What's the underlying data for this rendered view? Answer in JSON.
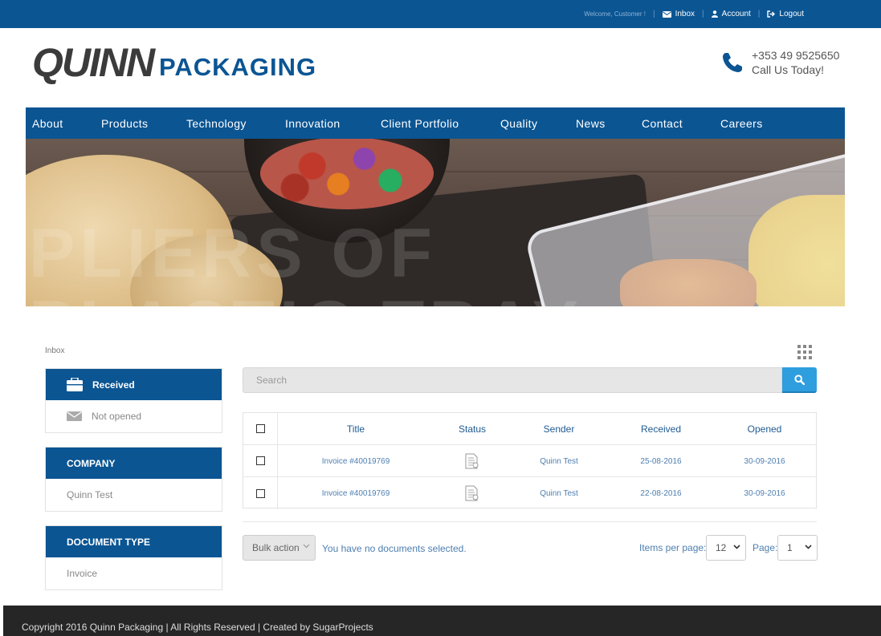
{
  "topbar": {
    "welcome": "Welcome, Customer !",
    "inbox": "Inbox",
    "account": "Account",
    "logout": "Logout"
  },
  "logo": {
    "word1": "QUINN",
    "word2": "PACKAGING"
  },
  "contact": {
    "phone": "+353 49 9525650",
    "tagline": "Call Us Today!"
  },
  "nav": [
    "About",
    "Products",
    "Technology",
    "Innovation",
    "Client Portfolio",
    "Quality",
    "News",
    "Contact",
    "Careers"
  ],
  "hero": {
    "watermark_line1": "PLIERS OF",
    "watermark_line2": "PLASTIC TRAY"
  },
  "breadcrumb": "Inbox",
  "sidebar": {
    "mailbox": {
      "received": "Received",
      "not_opened": "Not opened"
    },
    "company": {
      "heading": "COMPANY",
      "value": "Quinn Test"
    },
    "document_type": {
      "heading": "DOCUMENT TYPE",
      "value": "Invoice"
    }
  },
  "search": {
    "placeholder": "Search"
  },
  "table": {
    "headers": [
      "Title",
      "Status",
      "Sender",
      "Received",
      "Opened"
    ],
    "rows": [
      {
        "title": "Invoice #40019769",
        "status": "document-icon",
        "sender": "Quinn Test",
        "received": "25-08-2016",
        "opened": "30-09-2016"
      },
      {
        "title": "Invoice #40019769",
        "status": "document-icon",
        "sender": "Quinn Test",
        "received": "22-08-2016",
        "opened": "30-09-2016"
      }
    ]
  },
  "actions": {
    "bulk": "Bulk action",
    "selection_status": "You have no documents selected.",
    "items_per_page_label": "Items per page:",
    "items_per_page": "12",
    "page_label": "Page:",
    "page": "1"
  },
  "footer": {
    "copyright": "Copyright 2016 Quinn Packaging | All Rights Reserved | Created by SugarProjects"
  },
  "colors": {
    "brand": "#0b5593",
    "accent": "#2e9ede",
    "footer": "#262626"
  }
}
